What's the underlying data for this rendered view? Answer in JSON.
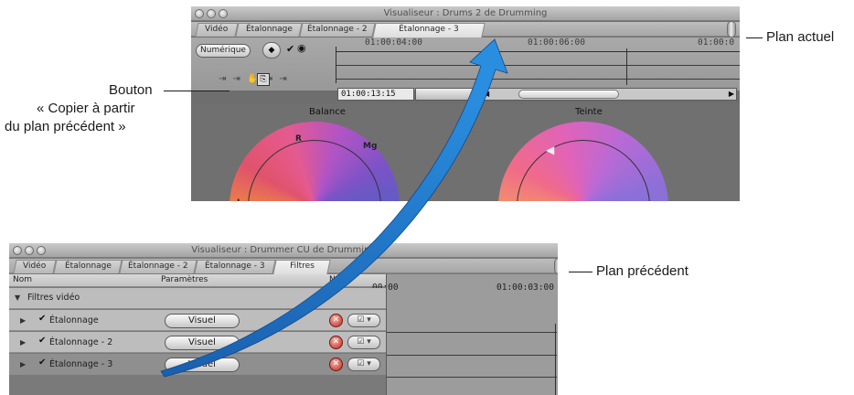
{
  "viewer_top": {
    "title": "Visualiseur : Drums 2 de Drumming",
    "tabs": [
      "Vidéo",
      "Étalonnage",
      "Étalonnage - 2",
      "Étalonnage - 3"
    ],
    "active_tab": "Étalonnage - 3",
    "numeric_button": "Numérique",
    "timecodes": [
      "01:00:04:00",
      "01:00:06:00",
      "01:00:0"
    ],
    "current_timecode": "01:00:13:15",
    "wheels": [
      "Balance",
      "Teinte"
    ],
    "wheel_marks": [
      "R",
      "Mg",
      "J"
    ]
  },
  "viewer_bottom": {
    "title": "Visualiseur : Drummer CU de Drumming",
    "tabs": [
      "Vidéo",
      "Étalonnage",
      "Étalonnage - 2",
      "Étalonnage - 3",
      "Filtres"
    ],
    "active_tab": "Filtres",
    "columns": [
      "Nom",
      "Paramètres",
      "N"
    ],
    "timecodes": [
      "00:00",
      "01:00:03:00"
    ],
    "group_label": "Filtres vidéo",
    "rows": [
      {
        "name": "Étalonnage",
        "button": "Visuel"
      },
      {
        "name": "Étalonnage - 2",
        "button": "Visuel"
      },
      {
        "name": "Étalonnage - 3",
        "button": "Visuel"
      }
    ]
  },
  "callouts": {
    "current_clip": "Plan actuel",
    "previous_clip": "Plan précédent",
    "button_line1": "Bouton",
    "button_line2": "« Copier à partir",
    "button_line3": "du plan précédent »"
  },
  "colors": {
    "arrow": "#1f78c8",
    "window_bg": "#6e6e6e",
    "selected_row": "#8f8f8f"
  }
}
